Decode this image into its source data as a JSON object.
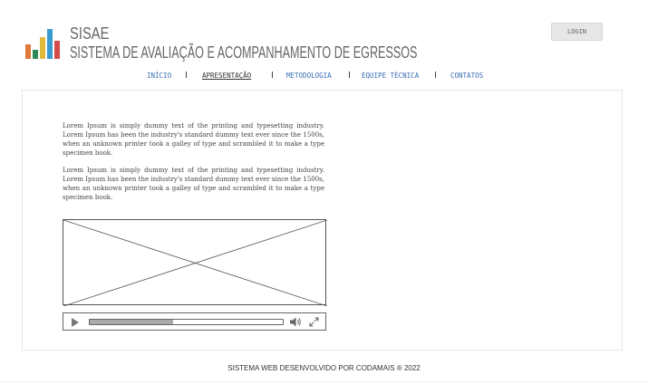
{
  "header": {
    "app_name": "SISAE",
    "app_fullname": "SISTEMA DE AVALIAÇÃO E ACOMPANHAMENTO DE EGRESSOS",
    "login_label": "LOGIN",
    "logo_colors": [
      "#e07a3a",
      "#2e8b57",
      "#e0b83a",
      "#3a9bd0",
      "#d24a4a"
    ]
  },
  "nav": {
    "items": [
      {
        "label": "INÍCIO",
        "active": false
      },
      {
        "label": "APRESENTAÇÃO",
        "active": true
      },
      {
        "label": "METODOLOGIA",
        "active": false
      },
      {
        "label": "EQUIPE TÉCNICA",
        "active": false
      },
      {
        "label": "CONTATOS",
        "active": false
      }
    ]
  },
  "content": {
    "paragraphs": [
      "Lorem Ipsum is simply dummy text of the printing and typesetting industry. Lorem Ipsum has been the industry's standard dummy text ever since the 1500s, when an unknown printer took a galley of type and scrambled it to make a type specimen book.",
      "Lorem Ipsum is simply dummy text of the printing and typesetting industry. Lorem Ipsum has been the industry's standard dummy text ever since the 1500s, when an unknown printer took a galley of type and scrambled it to make a type specimen book."
    ],
    "video": {
      "placeholder_icon": "video-placeholder-icon",
      "progress_fraction": 0.43,
      "controls": [
        "play-icon",
        "volume-icon",
        "fullscreen-icon"
      ]
    }
  },
  "footer": {
    "text": "SISTEMA WEB DESENVOLVIDO POR CODAMAIS ® 2022"
  }
}
